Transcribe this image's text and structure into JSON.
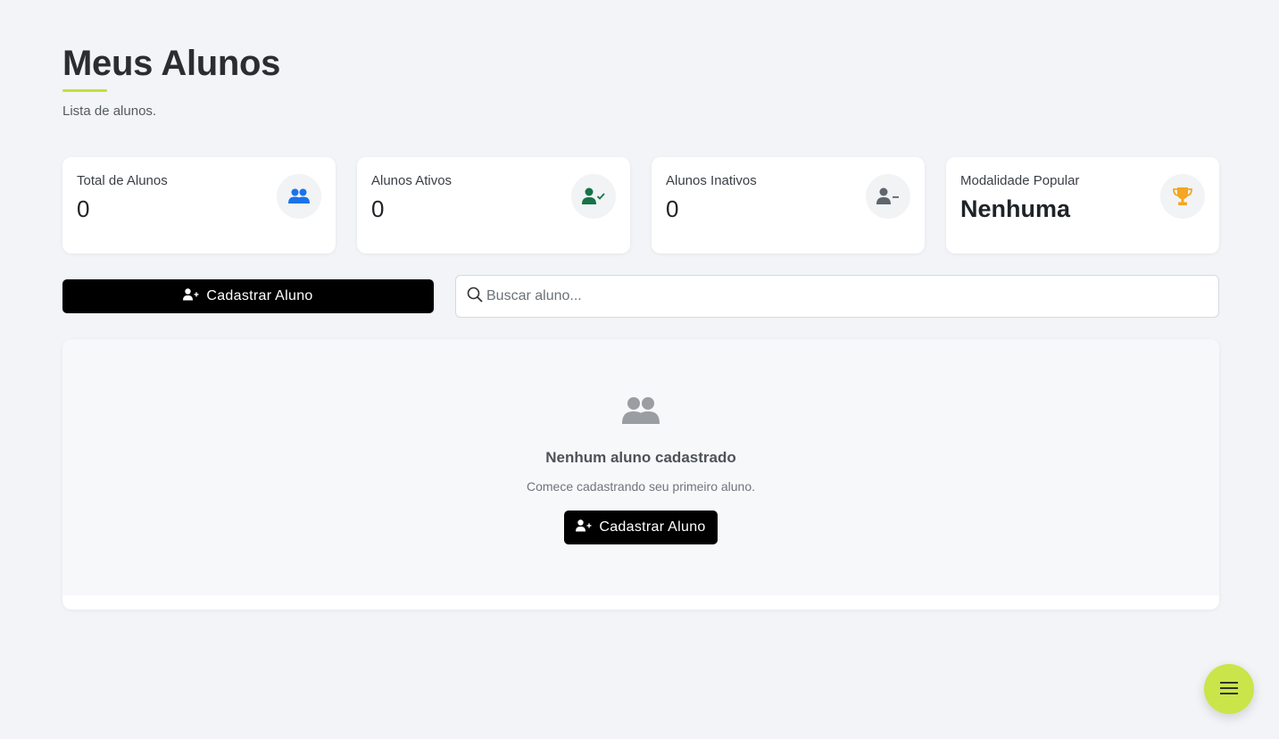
{
  "header": {
    "title": "Meus Alunos",
    "subtitle": "Lista de alunos."
  },
  "stats": [
    {
      "label": "Total de Alunos",
      "value": "0",
      "icon": "users-icon",
      "icon_color": "#1a73e8"
    },
    {
      "label": "Alunos Ativos",
      "value": "0",
      "icon": "user-check-icon",
      "icon_color": "#157347"
    },
    {
      "label": "Alunos Inativos",
      "value": "0",
      "icon": "user-minus-icon",
      "icon_color": "#5f666d"
    },
    {
      "label": "Modalidade Popular",
      "value": "Nenhuma",
      "icon": "trophy-icon",
      "icon_color": "#f5a623"
    }
  ],
  "actions": {
    "register_label": "Cadastrar Aluno",
    "search_placeholder": "Buscar aluno..."
  },
  "empty_state": {
    "title": "Nenhum aluno cadastrado",
    "subtitle": "Comece cadastrando seu primeiro aluno.",
    "button_label": "Cadastrar Aluno",
    "icon": "users-icon"
  },
  "fab": {
    "icon": "menu-icon"
  },
  "colors": {
    "accent": "#c4e03a",
    "fab": "#c9e54a",
    "primary_button": "#000000"
  }
}
